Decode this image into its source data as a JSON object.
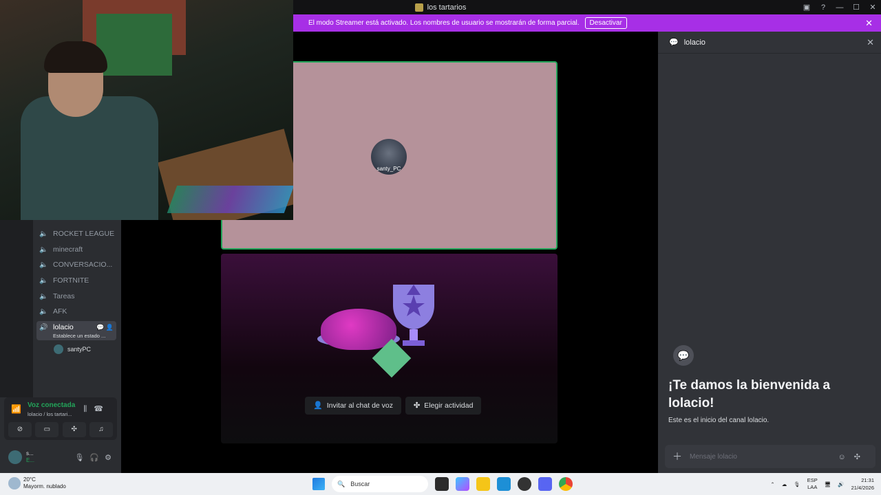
{
  "window": {
    "title": "los tartarios"
  },
  "banner": {
    "text": "El modo Streamer está activado. Los nombres de usuario se mostrarán de forma parcial.",
    "button": "Desactivar"
  },
  "sidebar": {
    "channels": [
      {
        "label": "ROCKET LEAGUE"
      },
      {
        "label": "minecraft"
      },
      {
        "label": "CONVERSACIO..."
      },
      {
        "label": "FORTNITE"
      },
      {
        "label": "Tareas"
      },
      {
        "label": "AFK"
      }
    ],
    "active_channel": {
      "label": "lolacio",
      "status": "Establece un estado ..."
    },
    "voice_user": "santyPC"
  },
  "voice_panel": {
    "title": "Voz conectada",
    "subtitle": "lolacio / los tartari..."
  },
  "userbar": {
    "name": "s...",
    "status": "E..."
  },
  "stage": {
    "user_tile_name": "santy_PC",
    "invite_button": "Invitar al chat de voz",
    "activity_button": "Elegir actividad"
  },
  "chat": {
    "channel": "lolacio",
    "welcome": "¡Te damos la bienvenida a lolacio!",
    "subtitle": "Este es el inicio del canal lolacio.",
    "input_placeholder": "Mensaje lolacio"
  },
  "taskbar": {
    "temp": "20°C",
    "weather": "Mayorm. nublado",
    "search_placeholder": "Buscar",
    "lang_1": "ESP",
    "lang_2": "LAA",
    "time": "21:31",
    "date": "21/4/2026"
  }
}
